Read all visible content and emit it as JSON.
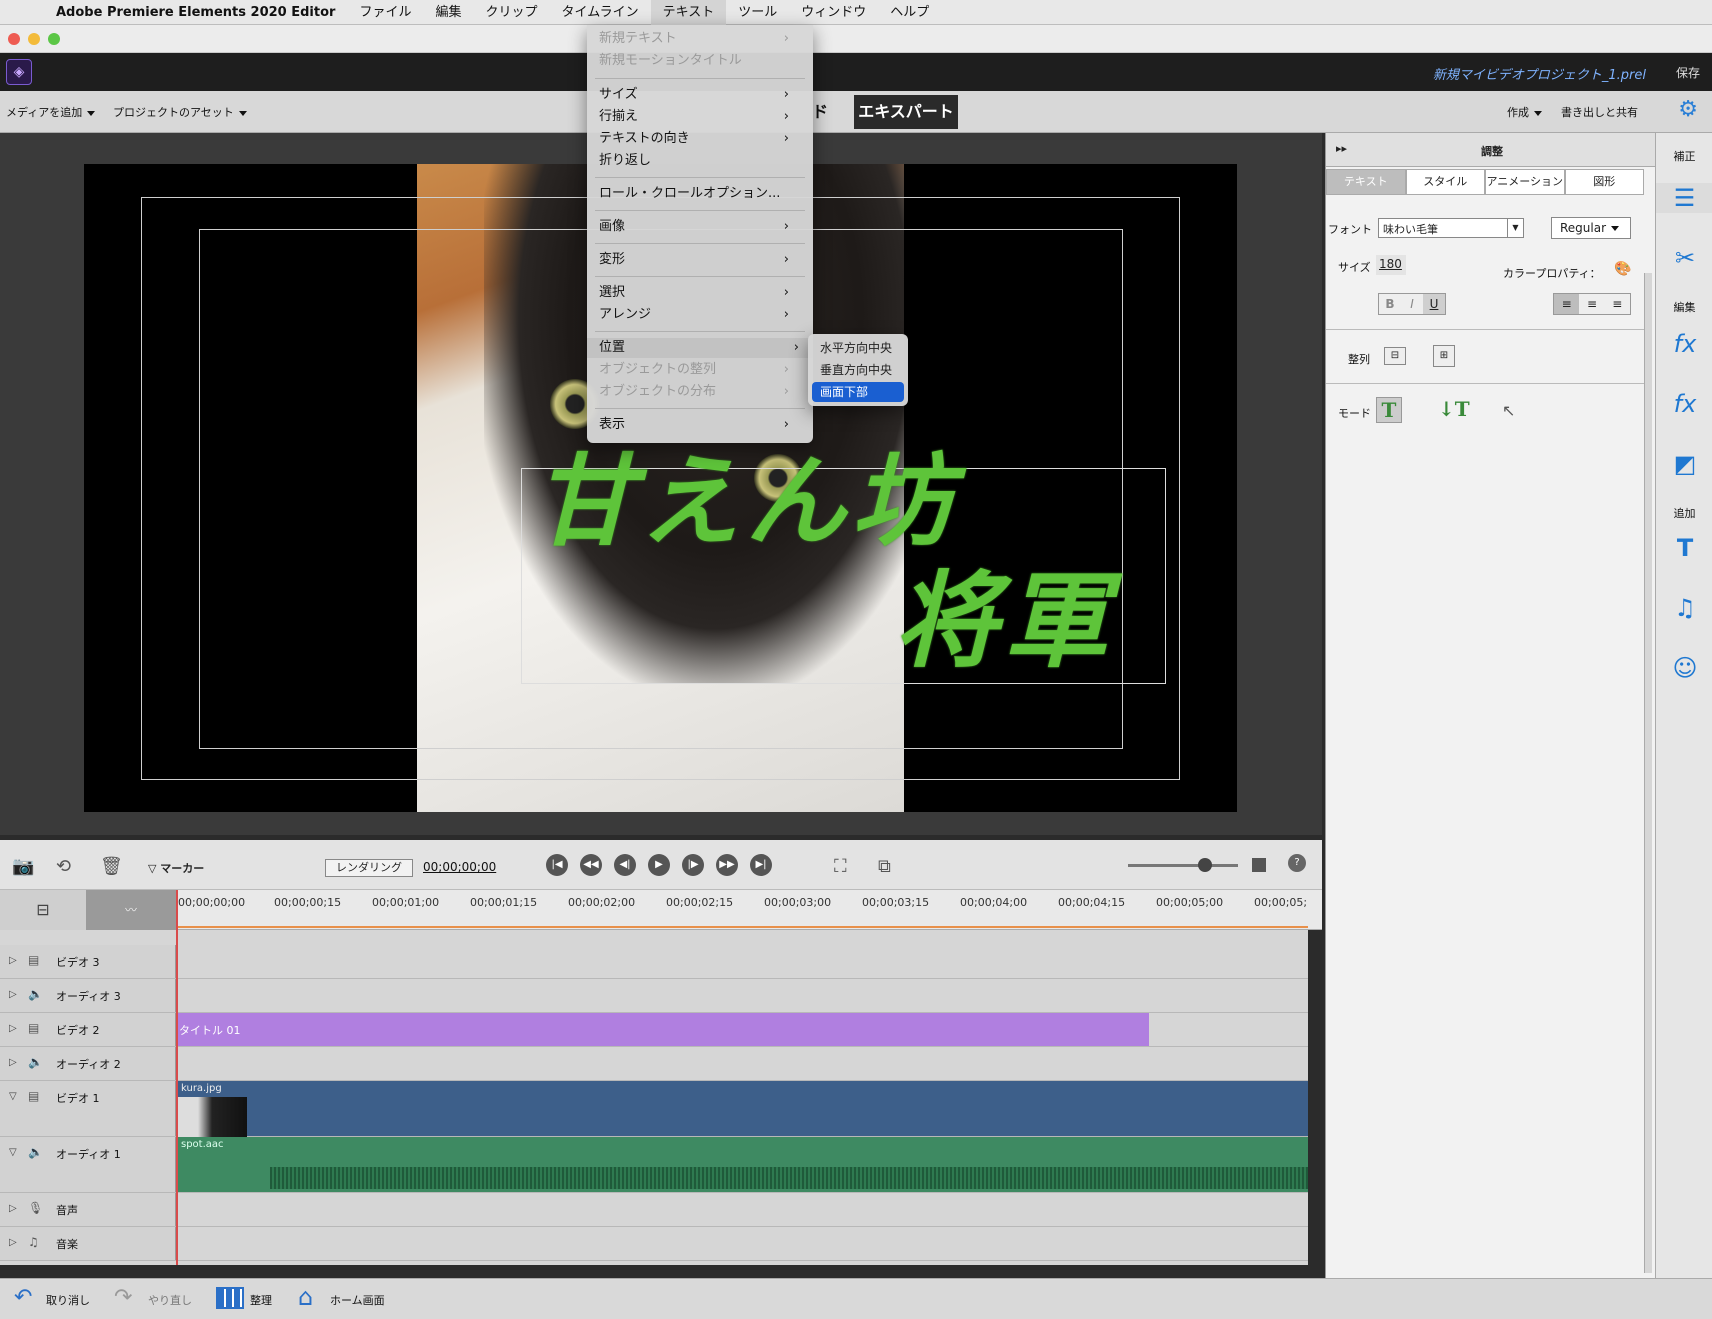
{
  "menubar": {
    "app": "Adobe Premiere Elements 2020 Editor",
    "items": [
      "ファイル",
      "編集",
      "クリップ",
      "タイムライン",
      "テキスト",
      "ツール",
      "ウィンドウ",
      "ヘルプ"
    ]
  },
  "appbar": {
    "project": "新規マイビデオプロジェクト_1.prel",
    "save": "保存"
  },
  "toolbar": {
    "add_media": "メディアを追加",
    "assets": "プロジェクトのアセット",
    "mode_guided_partial": "ド",
    "mode_expert": "エキスパート",
    "create": "作成",
    "export": "書き出しと共有"
  },
  "text_menu": {
    "items": [
      {
        "label": "新規テキスト",
        "disabled": true,
        "sub": true
      },
      {
        "label": "新規モーションタイトル",
        "disabled": true,
        "sub": false
      },
      {
        "label": "サイズ",
        "sub": true
      },
      {
        "label": "行揃え",
        "sub": true
      },
      {
        "label": "テキストの向き",
        "sub": true
      },
      {
        "label": "折り返し",
        "sub": false
      },
      {
        "label": "ロール・クロールオプション...",
        "sub": false
      },
      {
        "label": "画像",
        "sub": true
      },
      {
        "label": "変形",
        "sub": true
      },
      {
        "label": "選択",
        "sub": true
      },
      {
        "label": "アレンジ",
        "sub": true
      },
      {
        "label": "位置",
        "sub": true,
        "highlight": true
      },
      {
        "label": "オブジェクトの整列",
        "disabled": true,
        "sub": true
      },
      {
        "label": "オブジェクトの分布",
        "disabled": true,
        "sub": true
      },
      {
        "label": "表示",
        "sub": true
      }
    ]
  },
  "position_submenu": {
    "items": [
      "水平方向中央",
      "垂直方向中央",
      "画面下部"
    ],
    "selected": "画面下部"
  },
  "monitor": {
    "title_line1": "甘えん坊",
    "title_line2": "将軍",
    "title_color": "#5ec43a"
  },
  "timeline": {
    "marker": "マーカー",
    "render": "レンダリング",
    "timecode": "00;00;00;00",
    "ruler": [
      "00;00;00;00",
      "00;00;00;15",
      "00;00;01;00",
      "00;00;01;15",
      "00;00;02;00",
      "00;00;02;15",
      "00;00;03;00",
      "00;00;03;15",
      "00;00;04;00",
      "00;00;04;15",
      "00;00;05;00",
      "00;00;05;"
    ],
    "tracks": [
      {
        "name": "ビデオ 3",
        "type": "video"
      },
      {
        "name": "オーディオ 3",
        "type": "audio"
      },
      {
        "name": "ビデオ 2",
        "type": "video",
        "clip": "タイトル 01"
      },
      {
        "name": "オーディオ 2",
        "type": "audio"
      },
      {
        "name": "ビデオ 1",
        "type": "video",
        "clip": "kura.jpg"
      },
      {
        "name": "オーディオ 1",
        "type": "audio",
        "clip": "spot.aac"
      },
      {
        "name": "音声",
        "type": "voice"
      },
      {
        "name": "音楽",
        "type": "music"
      }
    ]
  },
  "adjust_panel": {
    "header": "調整",
    "tabs": [
      "テキスト",
      "スタイル",
      "アニメーション",
      "図形"
    ],
    "font_label": "フォント",
    "font_value": "味わい毛筆",
    "style_value": "Regular",
    "size_label": "サイズ",
    "size_value": "180",
    "color_label": "カラープロパティ：",
    "bold": "B",
    "italic": "I",
    "underline": "U",
    "align_label": "整列",
    "mode_label": "モード"
  },
  "sidebar": {
    "correct": "補正",
    "edit": "編集",
    "add": "追加"
  },
  "bottombar": {
    "undo": "取り消し",
    "redo": "やり直し",
    "organize": "整理",
    "home": "ホーム画面"
  }
}
